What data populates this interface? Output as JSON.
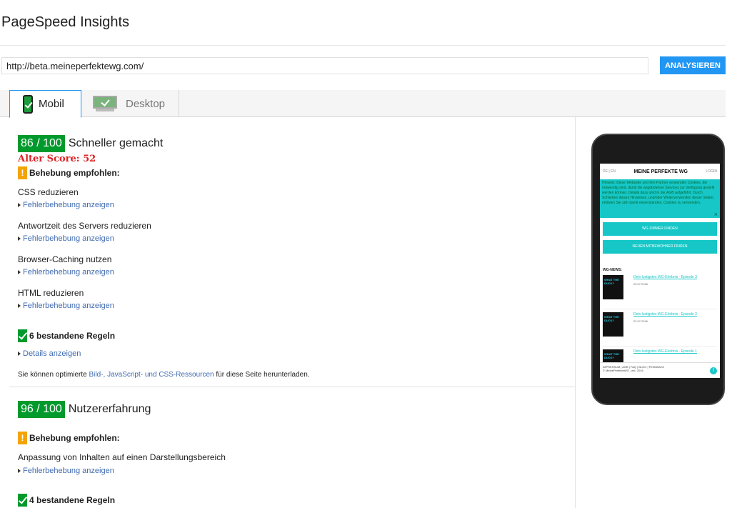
{
  "header": {
    "title": "PageSpeed Insights"
  },
  "search": {
    "url_value": "http://beta.meineperfektewg.com/",
    "analyze_label": "ANALYSIEREN"
  },
  "tabs": [
    {
      "label": "Mobil",
      "icon": "phone-icon",
      "selected": true
    },
    {
      "label": "Desktop",
      "icon": "monitor-icon",
      "selected": false
    }
  ],
  "speed": {
    "score": "86 / 100",
    "title": "Schneller gemacht",
    "old_score": "Alter Score: 52",
    "recommend_label": "Behebung empfohlen:",
    "rules": [
      {
        "title": "CSS reduzieren",
        "link": "Fehlerbehebung anzeigen"
      },
      {
        "title": "Antwortzeit des Servers reduzieren",
        "link": "Fehlerbehebung anzeigen"
      },
      {
        "title": "Browser-Caching nutzen",
        "link": "Fehlerbehebung anzeigen"
      },
      {
        "title": "HTML reduzieren",
        "link": "Fehlerbehebung anzeigen"
      }
    ],
    "passed_label": "6 bestandene Regeln",
    "details_link": "Details anzeigen",
    "note_before": "Sie können optimierte ",
    "note_link": "Bild-, JavaScript- und CSS-Ressourcen",
    "note_after": " für diese Seite herunterladen."
  },
  "ux": {
    "score": "96 / 100",
    "title": "Nutzererfahrung",
    "recommend_label": "Behebung empfohlen:",
    "rules": [
      {
        "title": "Anpassung von Inhalten auf einen Darstellungsbereich",
        "link": "Fehlerbehebung anzeigen"
      }
    ],
    "passed_label": "4 bestandene Regeln"
  },
  "preview": {
    "top_left": "DE | EN",
    "logo": "MEINE PERFEKTE WG",
    "top_right": "LOGIN",
    "cookie_text": "Hinweis: Diese Webseite und ihre Partner verwenden Cookies, die notwendig sind, damit die angebotenen Services zur Verfügung gestellt werden können. Details dazu sind in der AGB aufgeführt. Durch Schließen dieses Hinweises, und/oder Weiterverwenden dieser Seiten, erklären Sie sich damit einverstanden, Cookies zu verwenden.",
    "close": "×",
    "btn_rooms": "WG ZIMMER FINDEN",
    "btn_flatmates": "NEUEN MITBEWOHNER FINDEN",
    "news_label": "WG-NEWS:",
    "news": [
      {
        "thumb": "WHAT THE DUCK?",
        "title": "Dein lustigstes WG-Erlebnis - Episode 3",
        "date": "29.07.2016"
      },
      {
        "thumb": "WHAT THE DUCK?",
        "title": "Dein lustigstes WG-Erlebnis - Episode 2",
        "date": "22.07.2016"
      },
      {
        "thumb": "WHAT THE DUCK?",
        "title": "Dein lustigstes WG-Erlebnis - Episode 1",
        "date": ""
      }
    ],
    "footer_links": "IMPRESSUM | AGB | FAQ | BLOG | FEEDBACK",
    "footer_copy": "© MeinePerfekteWG - est. 2016",
    "fb": "f"
  },
  "colors": {
    "score_green": "#009a2c",
    "warn_orange": "#f4a400",
    "button_blue": "#2196f3",
    "alert_red": "#dd2222",
    "link_blue": "#3f6bb0"
  }
}
